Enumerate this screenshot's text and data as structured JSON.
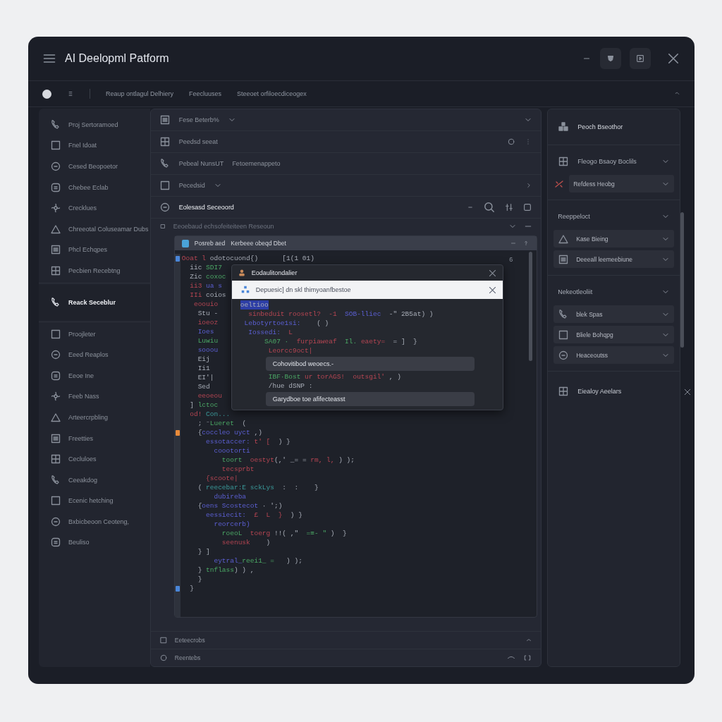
{
  "window": {
    "title": "AI Deelopml Patform"
  },
  "toolbar": {
    "items": [
      "Reaup ontlagul Delhiery",
      "Feecluuses",
      "Steeoet orfiloecdiceogex"
    ]
  },
  "sidebar": {
    "groups": [
      {
        "items": [
          {
            "label": "Proj Sertoramoed",
            "selected": false
          },
          {
            "label": "Fnel Idoat",
            "selected": false
          },
          {
            "label": "Cesed Beopoetor",
            "selected": false
          },
          {
            "label": "Chebee Eclab",
            "selected": false
          },
          {
            "label": "Crecklues",
            "selected": false
          },
          {
            "label": "Chreeotal Coluseamar Dubs",
            "selected": false
          },
          {
            "label": "Phcl Echqpes",
            "selected": false
          },
          {
            "label": "Pecbien Recebtng",
            "selected": false
          }
        ]
      },
      {
        "items": [
          {
            "label": "Reack Seceblur",
            "selected": true
          }
        ]
      },
      {
        "items": [
          {
            "label": "Proojleter",
            "selected": false
          },
          {
            "label": "Eeed Reaplos",
            "selected": false
          },
          {
            "label": "Eeoe Ine",
            "selected": false
          },
          {
            "label": "Feeb Nass",
            "selected": false
          },
          {
            "label": "Arteercrpbling",
            "selected": false
          },
          {
            "label": "Freetties",
            "selected": false
          },
          {
            "label": "Cecluloes",
            "selected": false
          },
          {
            "label": "Ceeakdog",
            "selected": false
          },
          {
            "label": "Ecenic hetching",
            "selected": false
          },
          {
            "label": "Bxbicbeoon Ceoteng,",
            "selected": false
          },
          {
            "label": "Beuliso",
            "selected": false
          }
        ]
      }
    ]
  },
  "center": {
    "rows": [
      {
        "label": "Fese Beterb%",
        "note": "",
        "selected": false
      },
      {
        "label": "Peedsd seeat",
        "note": "",
        "selected": false
      },
      {
        "label": "Pebeal NunsUT",
        "note": "Fetoemenappeto",
        "selected": false
      },
      {
        "label": "Pecedsid",
        "note": "",
        "selected": false
      },
      {
        "label": "Eolesasd Seceoord",
        "note": "",
        "selected": true
      }
    ],
    "subheader": "Eeoebaud echsofeiteiteen Reseoun",
    "editor": {
      "tab_title": "Posreb aed",
      "tab_subtitle": "Kerbeee obeqd Dbet",
      "line_number": "6",
      "code_lines": [
        {
          "color": "#4a86d8",
          "tokens": [
            {
              "text": "Ooat l ",
              "kind": "keyword"
            },
            {
              "text": "odotocuond{)      [1(1 01)",
              "kind": "plain"
            }
          ]
        },
        {
          "tokens": [
            {
              "text": "  iic ",
              "kind": "plain"
            },
            {
              "text": "SDI7",
              "kind": "string"
            }
          ]
        },
        {
          "tokens": [
            {
              "text": "  Zic ",
              "kind": "plain"
            },
            {
              "text": "coxoc",
              "kind": "string"
            }
          ]
        },
        {
          "tokens": [
            {
              "text": "  ii3 ",
              "kind": "keyword"
            },
            {
              "text": "ua s",
              "kind": "function"
            }
          ]
        },
        {
          "tokens": [
            {
              "text": "  IIi ",
              "kind": "keyword"
            },
            {
              "text": "coios",
              "kind": "plain"
            }
          ]
        },
        {
          "tokens": [
            {
              "text": "   eoouio",
              "kind": "keyword"
            }
          ]
        },
        {
          "tokens": [
            {
              "text": "    Stu -",
              "kind": "plain"
            }
          ]
        },
        {
          "tokens": [
            {
              "text": "    ioeoz",
              "kind": "keyword"
            }
          ]
        },
        {
          "tokens": [
            {
              "text": "    Ioes",
              "kind": "function"
            }
          ]
        },
        {
          "tokens": [
            {
              "text": "    Luwiu",
              "kind": "string"
            }
          ]
        },
        {
          "tokens": [
            {
              "text": "    sooou",
              "kind": "function"
            }
          ]
        },
        {
          "tokens": [
            {
              "text": "    Eij",
              "kind": "plain"
            }
          ]
        },
        {
          "tokens": [
            {
              "text": "    Ii1",
              "kind": "plain"
            }
          ]
        },
        {
          "tokens": [
            {
              "text": "    EI'|",
              "kind": "plain"
            }
          ]
        },
        {
          "tokens": [
            {
              "text": "    Sed",
              "kind": "plain"
            }
          ]
        },
        {
          "tokens": [
            {
              "text": "    eeoeou",
              "kind": "keyword"
            }
          ]
        },
        {
          "tokens": [
            {
              "text": "  ] ",
              "kind": "plain"
            },
            {
              "text": "lctoc",
              "kind": "string"
            }
          ]
        },
        {
          "tokens": [
            {
              "text": "  od! ",
              "kind": "keyword"
            },
            {
              "text": "Con...",
              "kind": "type"
            }
          ]
        },
        {
          "tokens": [
            {
              "text": "    ; ⁻",
              "kind": "plain"
            },
            {
              "text": "Lueret",
              "kind": "string"
            },
            {
              "text": "  (",
              "kind": "plain"
            }
          ]
        },
        {
          "color": "#e88a3a",
          "tokens": [
            {
              "text": "    {",
              "kind": "plain"
            },
            {
              "text": "coccleo uyct",
              "kind": "function"
            },
            {
              "text": " ,)",
              "kind": "plain"
            }
          ]
        },
        {
          "tokens": [
            {
              "text": "      essotaccer:",
              "kind": "function"
            },
            {
              "text": " t' [",
              "kind": "keyword"
            },
            {
              "text": "  ) }",
              "kind": "plain"
            }
          ]
        },
        {
          "tokens": [
            {
              "text": "        coootorti",
              "kind": "function"
            }
          ]
        },
        {
          "tokens": [
            {
              "text": "          toort  ",
              "kind": "string"
            },
            {
              "text": "oestyt",
              "kind": "keyword"
            },
            {
              "text": "(,' _= = ",
              "kind": "plain"
            },
            {
              "text": "rm, l,",
              "kind": "keyword"
            },
            {
              "text": " ) );",
              "kind": "plain"
            }
          ]
        },
        {
          "tokens": [
            {
              "text": "          tecsprbt",
              "kind": "keyword"
            }
          ]
        },
        {
          "tokens": [
            {
              "text": "      {scoote|",
              "kind": "keyword"
            }
          ]
        },
        {
          "tokens": [
            {
              "text": "    ( ",
              "kind": "plain"
            },
            {
              "text": "reecebar:E sckLys",
              "kind": "type"
            },
            {
              "text": "  :  :    }",
              "kind": "plain"
            }
          ]
        },
        {
          "tokens": [
            {
              "text": "        dubireba",
              "kind": "function"
            }
          ]
        },
        {
          "tokens": [
            {
              "text": "    {",
              "kind": "plain"
            },
            {
              "text": "oens Scostecot",
              "kind": "function"
            },
            {
              "text": " · ';)",
              "kind": "plain"
            }
          ]
        },
        {
          "tokens": [
            {
              "text": "      eessiecit:",
              "kind": "function"
            },
            {
              "text": "  £  L  }",
              "kind": "keyword"
            },
            {
              "text": "  ) }",
              "kind": "plain"
            }
          ]
        },
        {
          "tokens": [
            {
              "text": "        reorcerb)",
              "kind": "function"
            }
          ]
        },
        {
          "tokens": [
            {
              "text": "          roeoL  ",
              "kind": "string"
            },
            {
              "text": "toerg",
              "kind": "keyword"
            },
            {
              "text": " !!( ,\"  ",
              "kind": "plain"
            },
            {
              "text": "=≡- \"",
              "kind": "string"
            },
            {
              "text": " )  }",
              "kind": "plain"
            }
          ]
        },
        {
          "tokens": [
            {
              "text": "          seenusk",
              "kind": "keyword"
            },
            {
              "text": "    )",
              "kind": "plain"
            }
          ]
        },
        {
          "tokens": [
            {
              "text": "    } ]",
              "kind": "plain"
            }
          ]
        },
        {
          "tokens": [
            {
              "text": "        eytral_",
              "kind": "function"
            },
            {
              "text": "reei1_ =",
              "kind": "string"
            },
            {
              "text": "   ) );",
              "kind": "plain"
            }
          ]
        },
        {
          "tokens": [
            {
              "text": "    } ",
              "kind": "plain"
            },
            {
              "text": "tnflass",
              "kind": "string"
            },
            {
              "text": ") ) ,",
              "kind": "plain"
            }
          ]
        },
        {
          "tokens": [
            {
              "text": "    }",
              "kind": "plain"
            }
          ]
        },
        {
          "color": "#4a86d8",
          "tokens": [
            {
              "text": "  }",
              "kind": "plain"
            }
          ]
        }
      ]
    },
    "popup": {
      "title": "Eodaulitondalier",
      "banner": "Depuesic] dn skl thimyoanfbestoe",
      "lines": [
        {
          "kind": "highlight",
          "tokens": [
            {
              "text": "oeltioo",
              "kind": "plain"
            }
          ]
        },
        {
          "kind": "code",
          "tokens": [
            {
              "text": "  sinbeduit roosetl?  -1  ",
              "kind": "keyword"
            },
            {
              "text": "SOB-lliec",
              "kind": "function"
            },
            {
              "text": "  -\" 2B5at) )",
              "kind": "plain"
            }
          ]
        },
        {
          "kind": "code",
          "tokens": [
            {
              "text": " Lebotyrtoe1si:",
              "kind": "function"
            },
            {
              "text": "    ( )",
              "kind": "plain"
            }
          ]
        },
        {
          "kind": "code",
          "tokens": [
            {
              "text": "  Iossedi:",
              "kind": "function"
            },
            {
              "text": "  L",
              "kind": "keyword"
            }
          ]
        },
        {
          "kind": "code",
          "tokens": [
            {
              "text": "      SA07 ·  ",
              "kind": "string"
            },
            {
              "text": "furpiaweaf",
              "kind": "keyword"
            },
            {
              "text": "  Il. ",
              "kind": "string"
            },
            {
              "text": "eaety=",
              "kind": "keyword"
            },
            {
              "text": "  = ]  }",
              "kind": "plain"
            }
          ]
        },
        {
          "kind": "code",
          "tokens": [
            {
              "text": "       Leorcc9oct|",
              "kind": "keyword"
            }
          ]
        },
        {
          "kind": "suggestion",
          "text": "Cohovitibod weoecs.-"
        },
        {
          "kind": "code",
          "tokens": [
            {
              "text": "       IBF·Bost ",
              "kind": "string"
            },
            {
              "text": "ur torAGS!  outsgil'",
              "kind": "keyword"
            },
            {
              "text": " , )",
              "kind": "plain"
            }
          ]
        },
        {
          "kind": "code",
          "tokens": [
            {
              "text": "       /hue dSNP :",
              "kind": "plain"
            }
          ]
        },
        {
          "kind": "suggestion",
          "text": "Garydboe toe afifecteasst"
        }
      ]
    },
    "footer_rows": [
      "Eeteecrobs",
      "Reentebs"
    ]
  },
  "right_panel": {
    "title": "Peoch Bseothor",
    "sections": [
      {
        "title": "Fleogo Bsaoy Boclils",
        "kind": "iconhead",
        "expanded": true,
        "items": [
          "Refdess Heobg"
        ]
      },
      {
        "title": "Reeppeloct",
        "kind": "plainhead",
        "expanded": true,
        "items": [
          "Kase Bieing",
          "Deeeall leemeebiune"
        ]
      },
      {
        "title": "Nekeotleoliit",
        "kind": "plainhead",
        "expanded": true,
        "items": [
          "blek Spas",
          "Bliele Bohqpg",
          "Heaceoutss"
        ]
      }
    ],
    "footer": "Eiealoy Aeelars"
  }
}
